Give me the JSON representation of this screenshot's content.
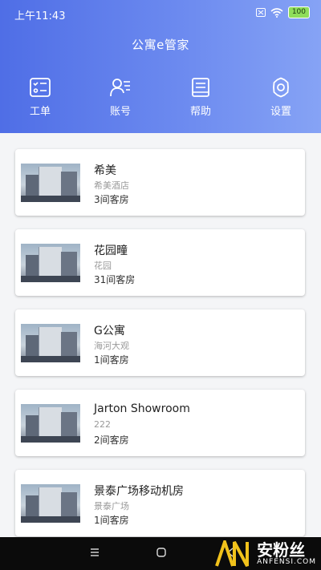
{
  "status": {
    "time": "上午11:43",
    "battery": "100"
  },
  "app": {
    "title": "公寓e管家"
  },
  "nav": [
    {
      "label": "工单",
      "icon": "checklist-icon"
    },
    {
      "label": "账号",
      "icon": "user-list-icon"
    },
    {
      "label": "帮助",
      "icon": "book-icon"
    },
    {
      "label": "设置",
      "icon": "gear-icon"
    }
  ],
  "properties": [
    {
      "name": "希美",
      "subtitle": "希美酒店",
      "rooms": "3间客房"
    },
    {
      "name": "花园疃",
      "subtitle": "花园",
      "rooms": "31间客房"
    },
    {
      "name": "G公寓",
      "subtitle": "海河大观",
      "rooms": "1间客房"
    },
    {
      "name": "Jarton Showroom",
      "subtitle": "222",
      "rooms": "2间客房"
    },
    {
      "name": "景泰广场移动机房",
      "subtitle": "景泰广场",
      "rooms": "1间客房"
    }
  ],
  "watermark": {
    "cn": "安粉丝",
    "en": "ANFENSI.COM",
    "logo": "AN"
  }
}
